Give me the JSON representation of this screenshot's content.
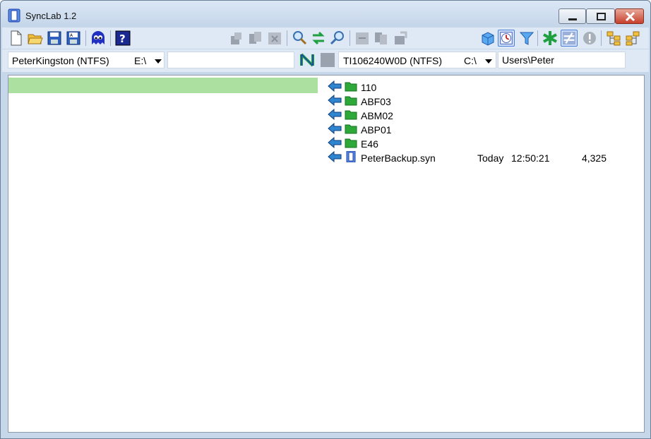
{
  "window": {
    "title": "SyncLab 1.2"
  },
  "toolbar": {
    "icons": [
      "new-file-icon",
      "open-folder-icon",
      "save-icon",
      "save-as-icon",
      "ghost-icon",
      "help-icon",
      "copy-left-icon",
      "copy-both-icon",
      "delete-icon",
      "search-icon",
      "sync-arrows-icon",
      "zoom-icon",
      "move-icon",
      "duplicate-icon",
      "paste-icon",
      "cube-icon",
      "clock-icon",
      "filter-icon",
      "asterisk-icon",
      "not-equal-icon",
      "alert-icon",
      "tree-left-icon",
      "tree-right-icon"
    ]
  },
  "left": {
    "volume": "PeterKingston (NTFS)",
    "drive": "E:\\",
    "path": ""
  },
  "right": {
    "volume": "TI106240W0D (NTFS)",
    "drive": "C:\\",
    "path": "Users\\Peter"
  },
  "files": [
    {
      "name": "110",
      "type": "folder",
      "date": "",
      "time": "",
      "size": ""
    },
    {
      "name": "ABF03",
      "type": "folder",
      "date": "",
      "time": "",
      "size": ""
    },
    {
      "name": "ABM02",
      "type": "folder",
      "date": "",
      "time": "",
      "size": ""
    },
    {
      "name": "ABP01",
      "type": "folder",
      "date": "",
      "time": "",
      "size": ""
    },
    {
      "name": "E46",
      "type": "folder",
      "date": "",
      "time": "",
      "size": ""
    },
    {
      "name": "PeterBackup.syn",
      "type": "syn-file",
      "date": "Today",
      "time": "12:50:21",
      "size": "4,325"
    }
  ],
  "colors": {
    "selection": "#abe0a0",
    "folder": "#2fa83a",
    "arrow": "#2f86d0",
    "accent": "#1f3fb0"
  }
}
